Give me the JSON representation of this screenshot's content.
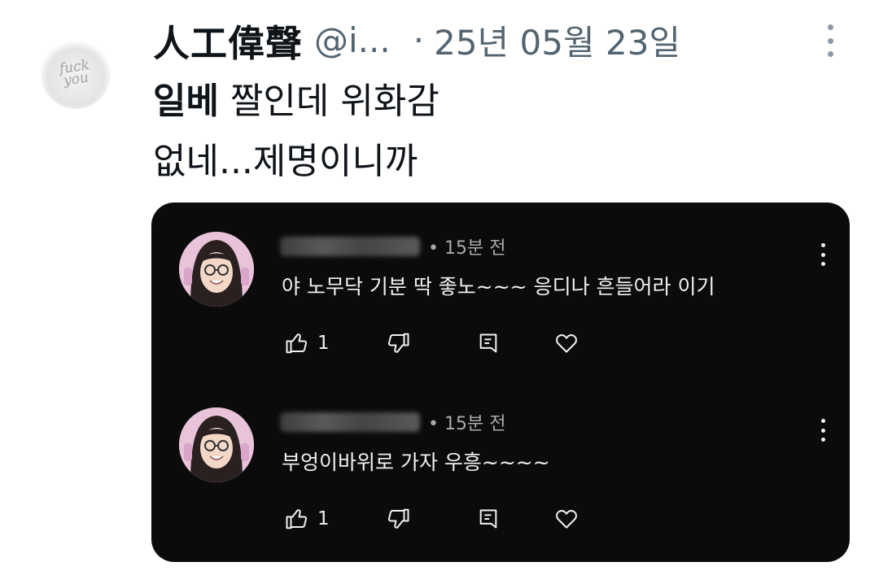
{
  "tweet": {
    "author_name": "人工偉聲",
    "handle": "@i...",
    "separator": "·",
    "date": "25년 05월 23일",
    "avatar_text_line1": "fuck",
    "avatar_text_line2": "you",
    "body_bold": "일베",
    "body_rest_line1": " 짤인데 위화감",
    "body_line2": "없네...제명이니까"
  },
  "comments": [
    {
      "username_blurred": "sasdfawerb",
      "dot": "•",
      "time": "15분 전",
      "text": "야 노무닥 기분 딱 좋노~~~ 응디나 흔들어라 이기",
      "likes": "1"
    },
    {
      "username_blurred": "sasdfawerb",
      "dot": "•",
      "time": "15분 전",
      "text": "부엉이바위로 가자 우흥~~~~",
      "likes": "1"
    }
  ],
  "colors": {
    "card_background": "#0b0b0b",
    "meta_gray": "#536471",
    "comment_text": "#f1f1f1"
  },
  "icons": {
    "like": "thumbs-up-icon",
    "dislike": "thumbs-down-icon",
    "reply": "reply-icon",
    "heart": "heart-icon",
    "more": "more-vertical-icon"
  }
}
